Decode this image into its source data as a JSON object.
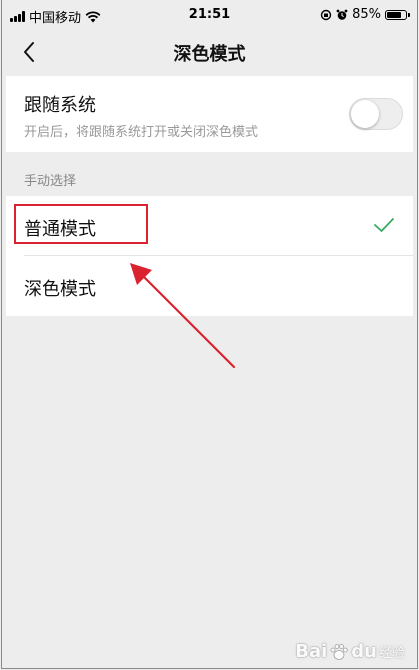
{
  "status_bar": {
    "carrier": "中国移动",
    "time": "21:51",
    "battery": "85%",
    "battery_level": 0.85
  },
  "nav": {
    "title": "深色模式"
  },
  "follow_system": {
    "title": "跟随系统",
    "description": "开启后，将跟随系统打开或关闭深色模式",
    "enabled": false
  },
  "manual": {
    "section_label": "手动选择",
    "options": [
      {
        "label": "普通模式",
        "selected": true
      },
      {
        "label": "深色模式",
        "selected": false
      }
    ]
  },
  "colors": {
    "check": "#3aaa5f",
    "annotation": "#d9242f"
  },
  "watermark": {
    "brand": "Bai",
    "brand_suffix": "du",
    "sub": "经验"
  }
}
